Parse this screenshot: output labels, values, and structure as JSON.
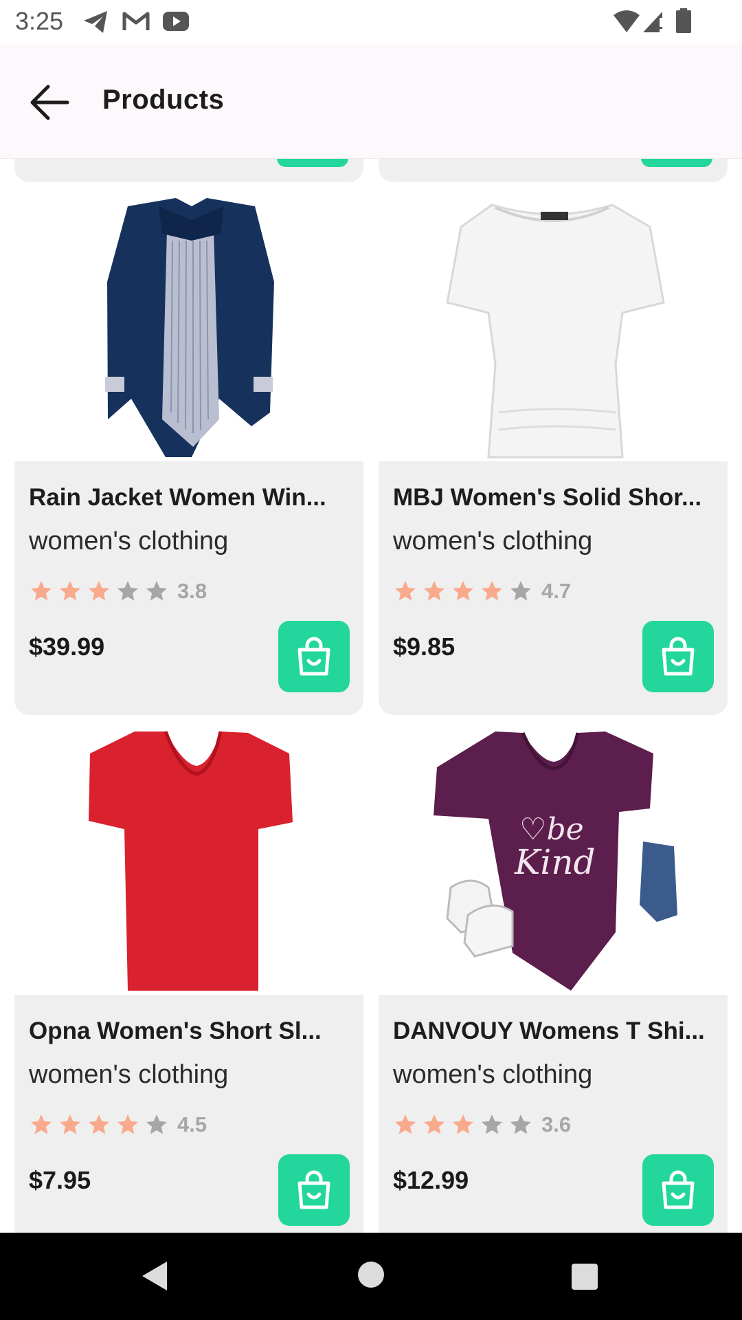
{
  "status_bar": {
    "time": "3:25",
    "icons": [
      "telegram-icon",
      "gmail-icon",
      "youtube-icon",
      "wifi-icon",
      "signal-icon",
      "battery-icon"
    ]
  },
  "app_bar": {
    "back_icon": "arrow-back-icon",
    "title": "Products"
  },
  "colors": {
    "accent": "#22d69c",
    "star_filled": "#f9a98c",
    "star_empty": "#a6a6a6",
    "card_bg": "#efefef",
    "app_bar_bg": "#fdf8fb"
  },
  "products": [
    {
      "name": "Rain Jacket Women Win...",
      "category": "women's clothing",
      "rating": 3.8,
      "rating_text": "3.8",
      "filled_stars": 3,
      "price": "$39.99",
      "cart_icon": "shopping-bag-icon"
    },
    {
      "name": "MBJ Women's Solid Shor...",
      "category": "women's clothing",
      "rating": 4.7,
      "rating_text": "4.7",
      "filled_stars": 4,
      "price": "$9.85",
      "cart_icon": "shopping-bag-icon"
    },
    {
      "name": "Opna Women's Short Sl...",
      "category": "women's clothing",
      "rating": 4.5,
      "rating_text": "4.5",
      "filled_stars": 4,
      "price": "$7.95",
      "cart_icon": "shopping-bag-icon"
    },
    {
      "name": "DANVOUY Womens T Shi...",
      "category": "women's clothing",
      "rating": 3.6,
      "rating_text": "3.6",
      "filled_stars": 3,
      "price": "$12.99",
      "cart_icon": "shopping-bag-icon"
    }
  ],
  "nav_bar": {
    "icons": [
      "nav-back-icon",
      "nav-home-icon",
      "nav-recents-icon"
    ]
  }
}
